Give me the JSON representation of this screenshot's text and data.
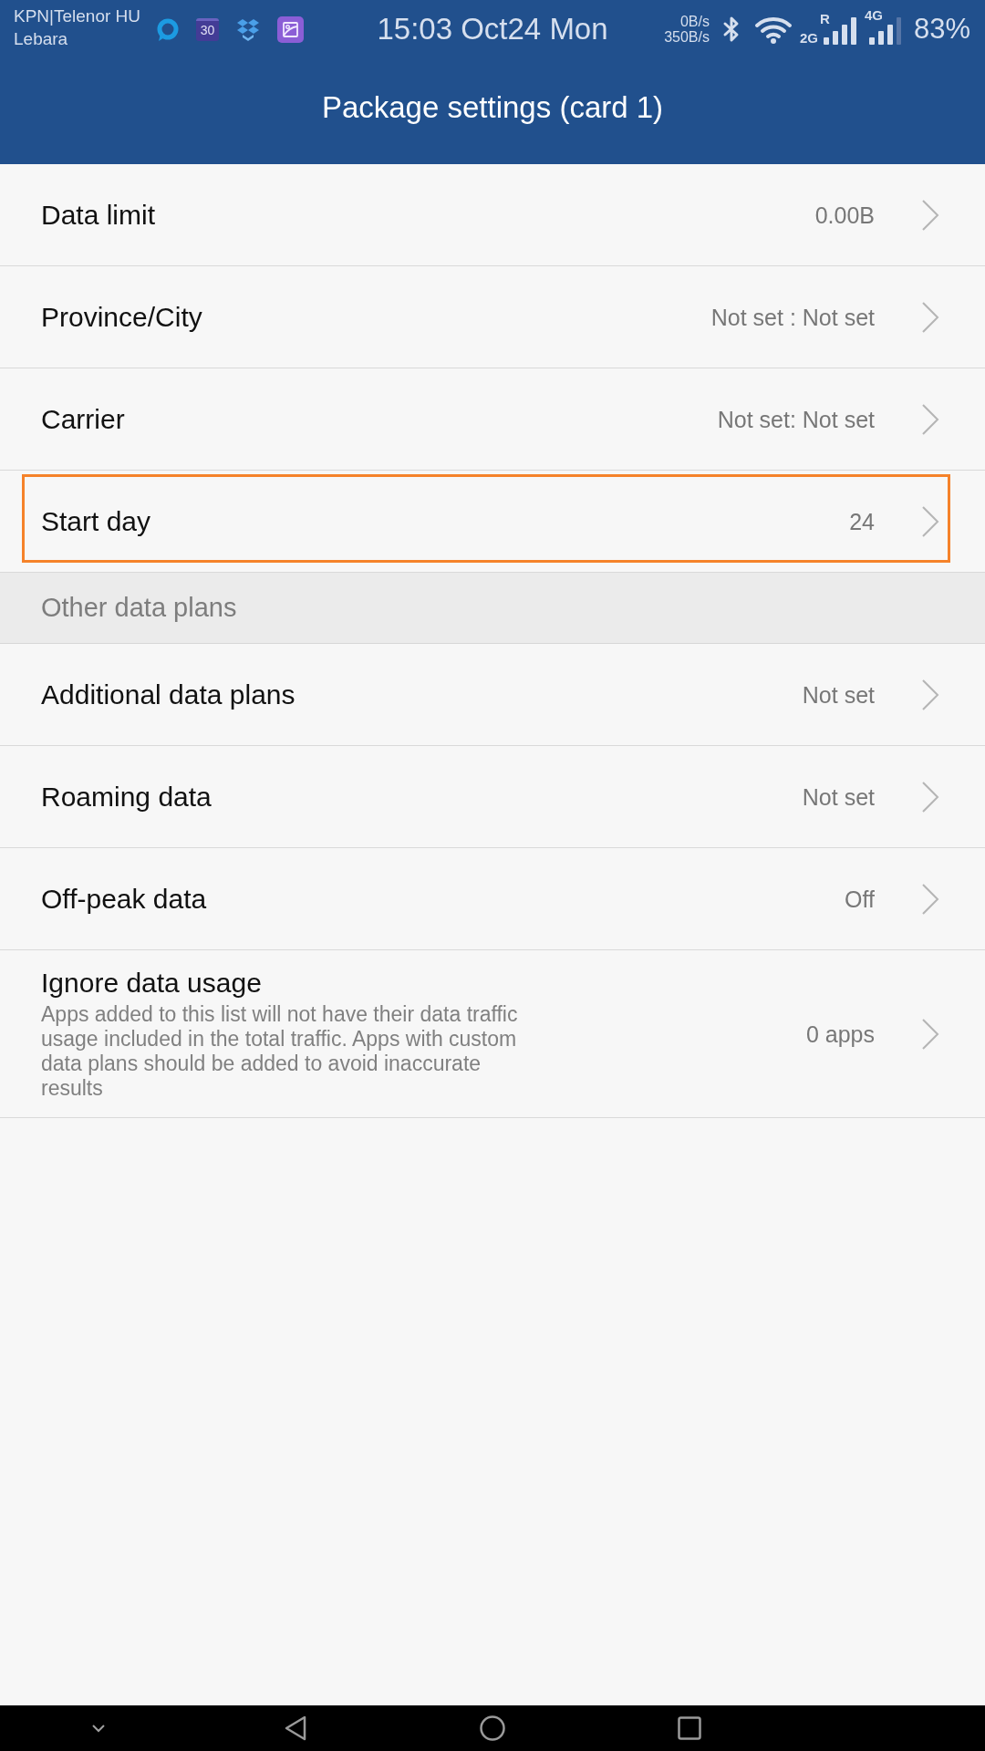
{
  "status_bar": {
    "carriers": [
      "KPN|Telenor HU",
      "Lebara"
    ],
    "calendar_day": "30",
    "time": "15:03 Oct24 Mon",
    "network_speeds": [
      "0B/s",
      "350B/s"
    ],
    "sim_1": {
      "network": "2G",
      "roaming": "R"
    },
    "sim_2": {
      "network": "4G"
    },
    "battery": "83%"
  },
  "header": {
    "title": "Package settings (card 1)"
  },
  "sections": [
    {
      "rows": [
        {
          "label": "Data limit",
          "value": "0.00B",
          "highlighted": false
        },
        {
          "label": "Province/City",
          "value": "Not set : Not set",
          "highlighted": false
        },
        {
          "label": "Carrier",
          "value": "Not set: Not set",
          "highlighted": false
        },
        {
          "label": "Start day",
          "value": "24",
          "highlighted": true
        }
      ]
    },
    {
      "title": "Other data plans",
      "rows": [
        {
          "label": "Additional data plans",
          "value": "Not set",
          "highlighted": false
        },
        {
          "label": "Roaming data",
          "value": "Not set",
          "highlighted": false
        },
        {
          "label": "Off-peak data",
          "value": "Off",
          "highlighted": false
        },
        {
          "label": "Ignore data usage",
          "description": "Apps added to this list will not have their data traffic usage included in the total traffic. Apps with custom data plans should be added to avoid inaccurate results",
          "value": "0 apps",
          "highlighted": false
        }
      ]
    }
  ]
}
